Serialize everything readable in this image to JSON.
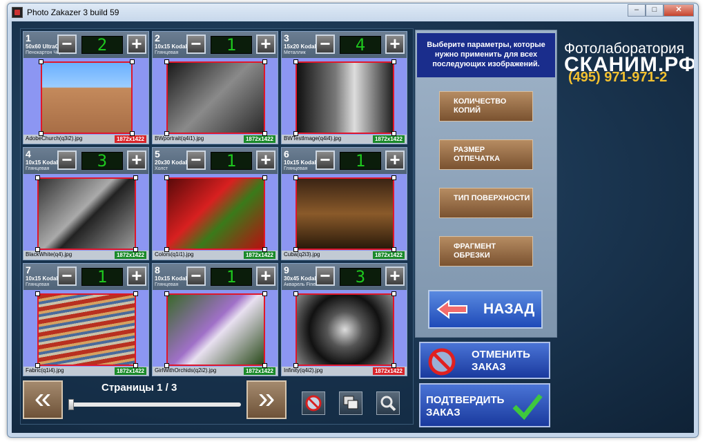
{
  "window": {
    "title": "Photo Zakazer 3 build 59",
    "minimize": "–",
    "maximize": "□",
    "close": "✕"
  },
  "cells": [
    {
      "num": "1",
      "size": "50x60 UltraChrome",
      "surface": "Пенокартон Черный",
      "qty": "2",
      "file": "AdobeChurch(q3i2).jpg",
      "res": "1872x1422",
      "res_status": "low"
    },
    {
      "num": "2",
      "size": "10x15 Kodak",
      "surface": "Глянцевая",
      "qty": "1",
      "file": "BWportrait(q4i1).jpg",
      "res": "1872x1422",
      "res_status": "ok"
    },
    {
      "num": "3",
      "size": "15x20 Kodak",
      "surface": "Металлик",
      "qty": "4",
      "file": "BWTestImage(q4i4).jpg",
      "res": "1872x1422",
      "res_status": "ok"
    },
    {
      "num": "4",
      "size": "10x15 Kodak",
      "surface": "Глянцевая",
      "qty": "3",
      "file": "BlackWhite(q4).jpg",
      "res": "1872x1422",
      "res_status": "ok"
    },
    {
      "num": "5",
      "size": "20x30 Kodak",
      "surface": "Холст",
      "qty": "1",
      "file": "Colors(q1i1).jpg",
      "res": "1872x1422",
      "res_status": "ok"
    },
    {
      "num": "6",
      "size": "10x15 Kodak",
      "surface": "Глянцевая",
      "qty": "1",
      "file": "Cuba(q2i3).jpg",
      "res": "1872x1422",
      "res_status": "ok"
    },
    {
      "num": "7",
      "size": "10x15 Kodak",
      "surface": "Глянцевая",
      "qty": "1",
      "file": "Fabric(q1i4).jpg",
      "res": "1872x1422",
      "res_status": "ok"
    },
    {
      "num": "8",
      "size": "10x15 Kodak",
      "surface": "Глянцевая",
      "qty": "1",
      "file": "GirlWithOrchids(q2i2).jpg",
      "res": "1872x1422",
      "res_status": "ok"
    },
    {
      "num": "9",
      "size": "30x45 Kodak",
      "surface": "Акварель Fine Art",
      "qty": "3",
      "file": "Infinity(q4i2).jpg",
      "res": "1872x1422",
      "res_status": "low"
    }
  ],
  "controls": {
    "minus": "−",
    "plus": "+"
  },
  "pager": {
    "label": "Страницы 1 / 3",
    "prev": "«",
    "next": "»",
    "position": 0
  },
  "panel": {
    "hint": "Выберите параметры, которые нужно применить для всех последующих изображений.",
    "options": [
      {
        "label": "КОЛИЧЕСТВО КОПИЙ"
      },
      {
        "label": "РАЗМЕР ОТПЕЧАТКА"
      },
      {
        "label": "ТИП ПОВЕРХНОСТИ"
      },
      {
        "label": "ФРАГМЕНТ ОБРЕЗКИ"
      }
    ],
    "back": "НАЗАД"
  },
  "actions": {
    "cancel": "ОТМЕНИТЬ ЗАКАЗ",
    "confirm": "ПОДТВЕРДИТЬ ЗАКАЗ"
  },
  "logo": {
    "line1": "Фотолаборатория",
    "line2": "СКАНИМ.РФ",
    "phone": "(495) 971-971-2"
  },
  "colors": {
    "res_ok": "#1a8a2a",
    "res_low": "#d8242a",
    "accent": "#1a2d8c"
  }
}
